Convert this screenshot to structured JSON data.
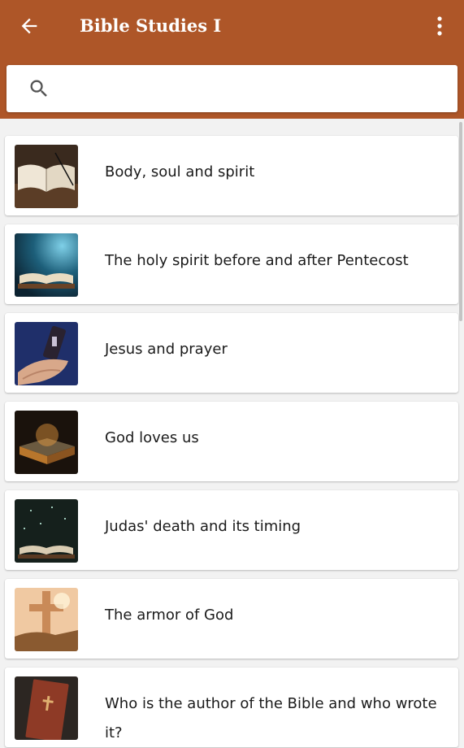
{
  "appbar": {
    "title": "Bible Studies I",
    "back_icon": "arrow-left-icon",
    "menu_icon": "more-vertical-icon",
    "color": "#ae5628"
  },
  "search": {
    "icon": "search-icon",
    "value": "",
    "placeholder": ""
  },
  "items": [
    {
      "label": "Body, soul and spirit"
    },
    {
      "label": "The holy spirit before and after Pentecost"
    },
    {
      "label": "Jesus and prayer"
    },
    {
      "label": "God loves us"
    },
    {
      "label": "Judas' death and its timing"
    },
    {
      "label": "The armor of God"
    },
    {
      "label": "Who is the author of the Bible and who wrote it?"
    }
  ]
}
